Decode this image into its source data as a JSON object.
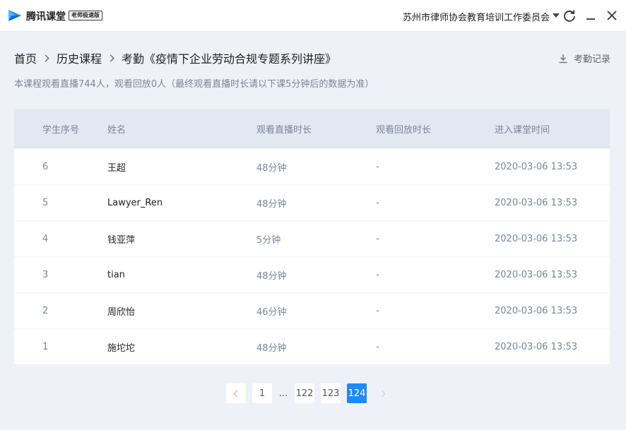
{
  "app": {
    "name": "腾讯课堂",
    "edition_badge": "老师极速版",
    "org_name": "苏州市律师协会教育培训工作委员会",
    "brand_color": "#1a8cff"
  },
  "breadcrumb": {
    "items": [
      "首页",
      "历史课程",
      "考勤《疫情下企业劳动合规专题系列讲座》"
    ]
  },
  "export": {
    "label": "考勤记录"
  },
  "summary": "本课程观看直播744人，观看回放0人（最终观看直播时长请以下课5分钟后的数据为准）",
  "table": {
    "headers": [
      "学生序号",
      "姓名",
      "观看直播时长",
      "观看回放时长",
      "进入课堂时间"
    ],
    "rows": [
      {
        "no": "6",
        "name": "王超",
        "live": "48分钟",
        "replay": "-",
        "enter": "2020-03-06 13:53"
      },
      {
        "no": "5",
        "name": "Lawyer_Ren",
        "live": "48分钟",
        "replay": "-",
        "enter": "2020-03-06 13:53"
      },
      {
        "no": "4",
        "name": "钱亚萍",
        "live": "5分钟",
        "replay": "-",
        "enter": "2020-03-06 13:53"
      },
      {
        "no": "3",
        "name": "tian",
        "live": "48分钟",
        "replay": "-",
        "enter": "2020-03-06 13:53"
      },
      {
        "no": "2",
        "name": "周欣怡",
        "live": "46分钟",
        "replay": "-",
        "enter": "2020-03-06 13:53"
      },
      {
        "no": "1",
        "name": "施坨坨",
        "live": "48分钟",
        "replay": "-",
        "enter": "2020-03-06 13:53"
      }
    ]
  },
  "pagination": {
    "pages": [
      "1",
      "…",
      "122",
      "123",
      "124"
    ],
    "current": "124"
  }
}
